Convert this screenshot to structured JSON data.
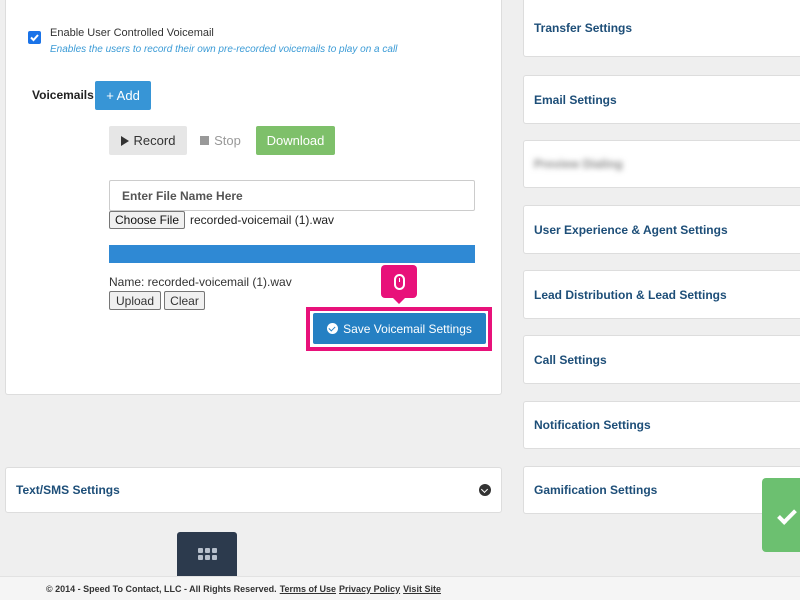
{
  "voicemail": {
    "enable_label": "Enable User Controlled Voicemail",
    "enable_help": "Enables the users to record their own pre-recorded voicemails to play on a call",
    "enable_checked": true,
    "section_label": "Voicemails",
    "add_label": "+ Add",
    "record_label": "Record",
    "stop_label": "Stop",
    "download_label": "Download",
    "filename_placeholder": "Enter File Name Here",
    "choose_file_label": "Choose File",
    "chosen_file": "recorded-voicemail (1).wav",
    "upload_progress": 1.0,
    "name_line": "Name: recorded-voicemail (1).wav",
    "upload_label": "Upload",
    "clear_label": "Clear",
    "save_label": "Save Voicemail Settings"
  },
  "right_panels": [
    {
      "label": "Transfer Settings"
    },
    {
      "label": "Email Settings"
    },
    {
      "label": "Preview Dialing"
    },
    {
      "label": "User Experience & Agent Settings"
    },
    {
      "label": "Lead Distribution & Lead Settings"
    },
    {
      "label": "Call Settings"
    },
    {
      "label": "Notification Settings"
    },
    {
      "label": "Gamification Settings"
    }
  ],
  "sms_panel": {
    "label": "Text/SMS Settings"
  },
  "footer": {
    "copyright": "© 2014 - Speed To Contact, LLC - All Rights Reserved.",
    "terms": "Terms of Use",
    "privacy": "Privacy Policy",
    "visit": "Visit Site"
  },
  "colors": {
    "accent_pink": "#e8117a",
    "primary_blue": "#2580c3",
    "download_green": "#7ec06a"
  }
}
